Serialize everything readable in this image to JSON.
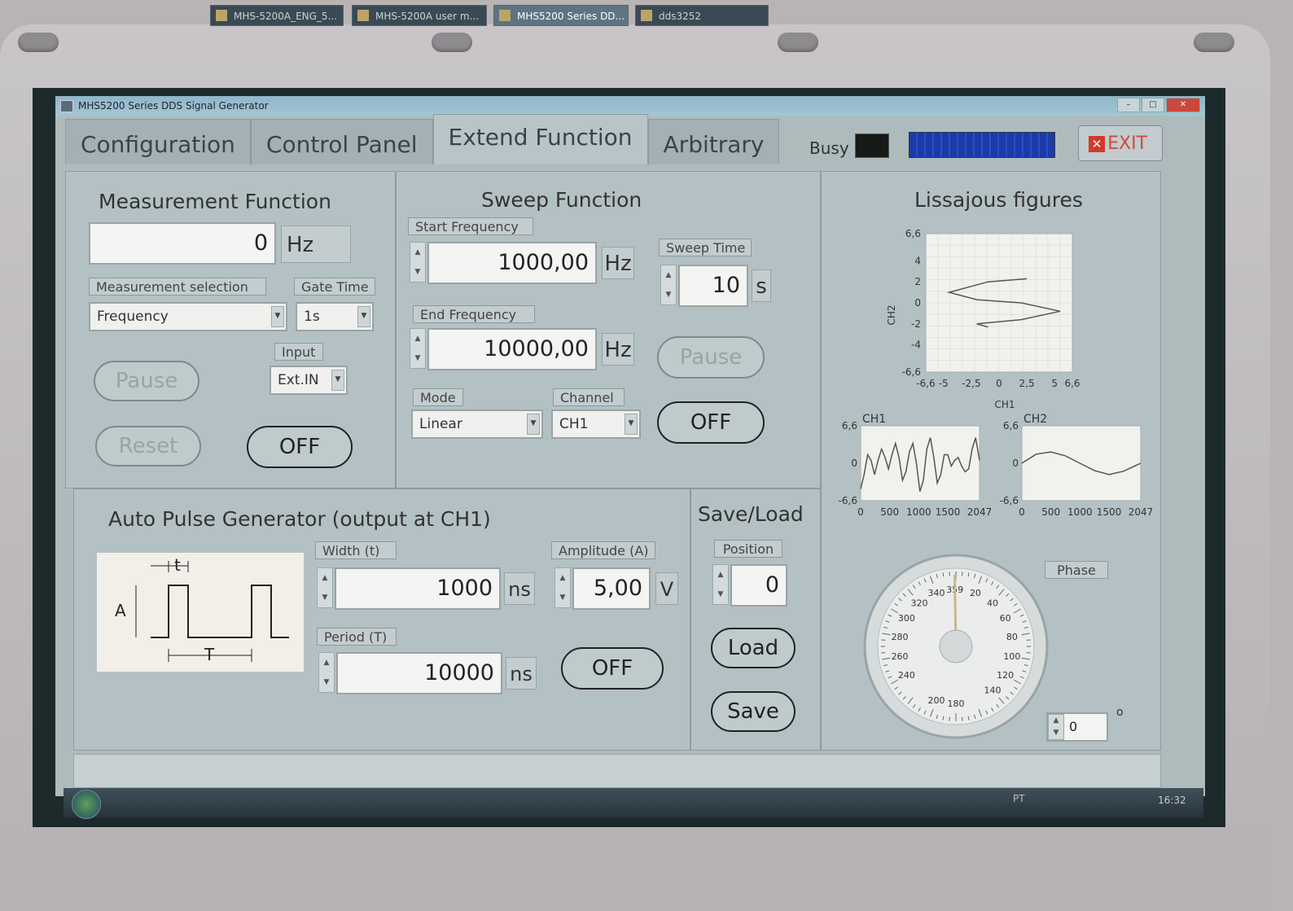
{
  "window": {
    "title": "MHS5200 Series DDS Signal Generator"
  },
  "tabs": [
    {
      "label": "Configuration",
      "active": false
    },
    {
      "label": "Control Panel",
      "active": false
    },
    {
      "label": "Extend Function",
      "active": true
    },
    {
      "label": "Arbitrary",
      "active": false
    }
  ],
  "header": {
    "busy_label": "Busy",
    "exit_label": "EXIT"
  },
  "measurement": {
    "title": "Measurement Function",
    "value": "0",
    "unit": "Hz",
    "selection_label": "Measurement selection",
    "selection_value": "Frequency",
    "gate_label": "Gate Time",
    "gate_value": "1s",
    "input_label": "Input",
    "input_value": "Ext.IN",
    "pause_label": "Pause",
    "reset_label": "Reset",
    "off_label": "OFF"
  },
  "sweep": {
    "title": "Sweep Function",
    "start_label": "Start Frequency",
    "start_value": "1000,00",
    "end_label": "End  Frequency",
    "end_value": "10000,00",
    "freq_unit": "Hz",
    "time_label": "Sweep Time",
    "time_value": "10",
    "time_unit": "s",
    "pause_label": "Pause",
    "off_label": "OFF",
    "mode_label": "Mode",
    "mode_value": "Linear",
    "channel_label": "Channel",
    "channel_value": "CH1"
  },
  "pulse": {
    "title": "Auto Pulse Generator (output at CH1)",
    "diagram_t": "t",
    "diagram_A": "A",
    "diagram_T": "T",
    "width_label": "Width (t)",
    "width_value": "1000",
    "width_unit": "ns",
    "period_label": "Period (T)",
    "period_value": "10000",
    "period_unit": "ns",
    "amp_label": "Amplitude (A)",
    "amp_value": "5,00",
    "amp_unit": "V",
    "off_label": "OFF"
  },
  "saveload": {
    "title": "Save/Load",
    "position_label": "Position",
    "position_value": "0",
    "load_label": "Load",
    "save_label": "Save"
  },
  "lissajous": {
    "title": "Lissajous figures",
    "x_label": "CH1",
    "y_label": "CH2",
    "y_ticks": [
      "6,6",
      "4",
      "2",
      "0",
      "-2",
      "-4",
      "-6,6"
    ],
    "x_ticks": [
      "-6,6",
      "-5",
      "-2,5",
      "0",
      "2,5",
      "5",
      "6,6"
    ],
    "ch1_title": "CH1",
    "ch2_title": "CH2",
    "small_y_ticks": [
      "6,6",
      "0",
      "-6,6"
    ],
    "small_x_ticks": [
      "0",
      "500",
      "1000",
      "1500",
      "2047"
    ]
  },
  "phase": {
    "label": "Phase",
    "value": "0",
    "degree_symbol": "o",
    "needle_value": "359",
    "dial_ticks": [
      "20",
      "40",
      "60",
      "80",
      "100",
      "120",
      "140",
      "180",
      "200",
      "240",
      "260",
      "280",
      "300",
      "320",
      "340",
      "359"
    ]
  },
  "taskbar": {
    "items": [
      "MHS-5200A_ENG_5...",
      "MHS-5200A user m...",
      "MHS5200 Series DD...",
      "dds3252"
    ],
    "lang": "PT",
    "clock": "16:32"
  },
  "chart_data": [
    {
      "type": "line",
      "title": "Lissajous figures",
      "xlabel": "CH1",
      "ylabel": "CH2",
      "xlim": [
        -6.6,
        6.6
      ],
      "ylim": [
        -6.6,
        6.6
      ],
      "x": [
        2.5,
        -1.0,
        -4.5,
        -2.0,
        2.0,
        5.5,
        2.0,
        -2.0,
        -1.0
      ],
      "y": [
        2.3,
        2.0,
        1.0,
        0.3,
        0.0,
        -0.8,
        -1.6,
        -2.0,
        -2.3
      ]
    },
    {
      "type": "line",
      "title": "CH1",
      "xlim": [
        0,
        2047
      ],
      "ylim": [
        -6.6,
        6.6
      ],
      "x": [
        0,
        60,
        120,
        180,
        240,
        300,
        360,
        420,
        480,
        540,
        600,
        660,
        720,
        780,
        840,
        900,
        960,
        1020,
        1080,
        1140,
        1200,
        1260,
        1320,
        1380,
        1440,
        1500,
        1560,
        1620,
        1680,
        1740,
        1800,
        1860,
        1920,
        1980,
        2047
      ],
      "y": [
        -4.5,
        -2.0,
        1.5,
        0.5,
        -2.0,
        0.5,
        2.5,
        1.0,
        -1.0,
        1.5,
        3.5,
        1.0,
        -3.0,
        -1.5,
        2.0,
        3.5,
        0.0,
        -5.0,
        -3.0,
        2.5,
        4.5,
        1.0,
        -3.5,
        -2.0,
        1.5,
        1.5,
        -0.5,
        0.5,
        1.0,
        -0.5,
        -1.5,
        -1.0,
        2.5,
        4.5,
        0.5
      ]
    },
    {
      "type": "line",
      "title": "CH2",
      "xlim": [
        0,
        2047
      ],
      "ylim": [
        -6.6,
        6.6
      ],
      "x": [
        0,
        250,
        500,
        750,
        1000,
        1250,
        1500,
        1750,
        2047
      ],
      "y": [
        0.0,
        1.6,
        2.0,
        1.3,
        0.0,
        -1.3,
        -2.0,
        -1.4,
        0.0
      ]
    }
  ]
}
